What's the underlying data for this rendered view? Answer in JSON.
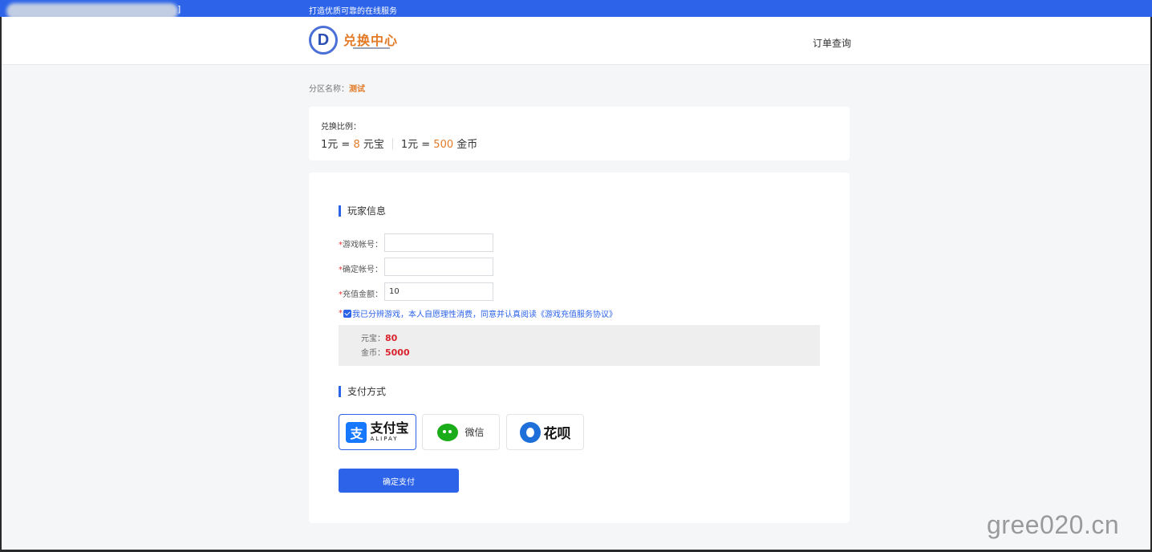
{
  "topbar": {
    "blurred_text_end": "]",
    "slogan": "打造优质可靠的在线服务"
  },
  "header": {
    "logo_letter": "D",
    "logo_title": "兑换中心",
    "order_query": "订单查询"
  },
  "zone": {
    "label": "分区名称：",
    "value": "测试"
  },
  "ratio": {
    "title": "兑换比例：",
    "items": [
      {
        "lhs": "1元 = ",
        "num": "8",
        "unit": " 元宝"
      },
      {
        "lhs": "1元 = ",
        "num": "500",
        "unit": " 金币"
      }
    ]
  },
  "player": {
    "section_title": "玩家信息",
    "fields": [
      {
        "label": "游戏帐号：",
        "value": ""
      },
      {
        "label": "确定帐号：",
        "value": ""
      },
      {
        "label": "充值金额：",
        "value": "10"
      }
    ],
    "required_mark": "*",
    "agreement": "我已分辨游戏，本人自愿理性消费，同意并认真阅读《游戏充值服务协议》"
  },
  "summary": {
    "rows": [
      {
        "label": "元宝：",
        "value": "80"
      },
      {
        "label": "金币：",
        "value": "5000"
      }
    ]
  },
  "payment": {
    "section_title": "支付方式",
    "alipay": {
      "icon": "支",
      "name": "支付宝",
      "sub": "ALIPAY"
    },
    "wechat": {
      "name": "微信"
    },
    "huabei": {
      "name": "花呗"
    },
    "submit": "确定支付"
  },
  "colors": {
    "accent": "#2c63e8",
    "orange": "#e37a26",
    "red": "#d9232d"
  },
  "watermark": "gree020.cn"
}
